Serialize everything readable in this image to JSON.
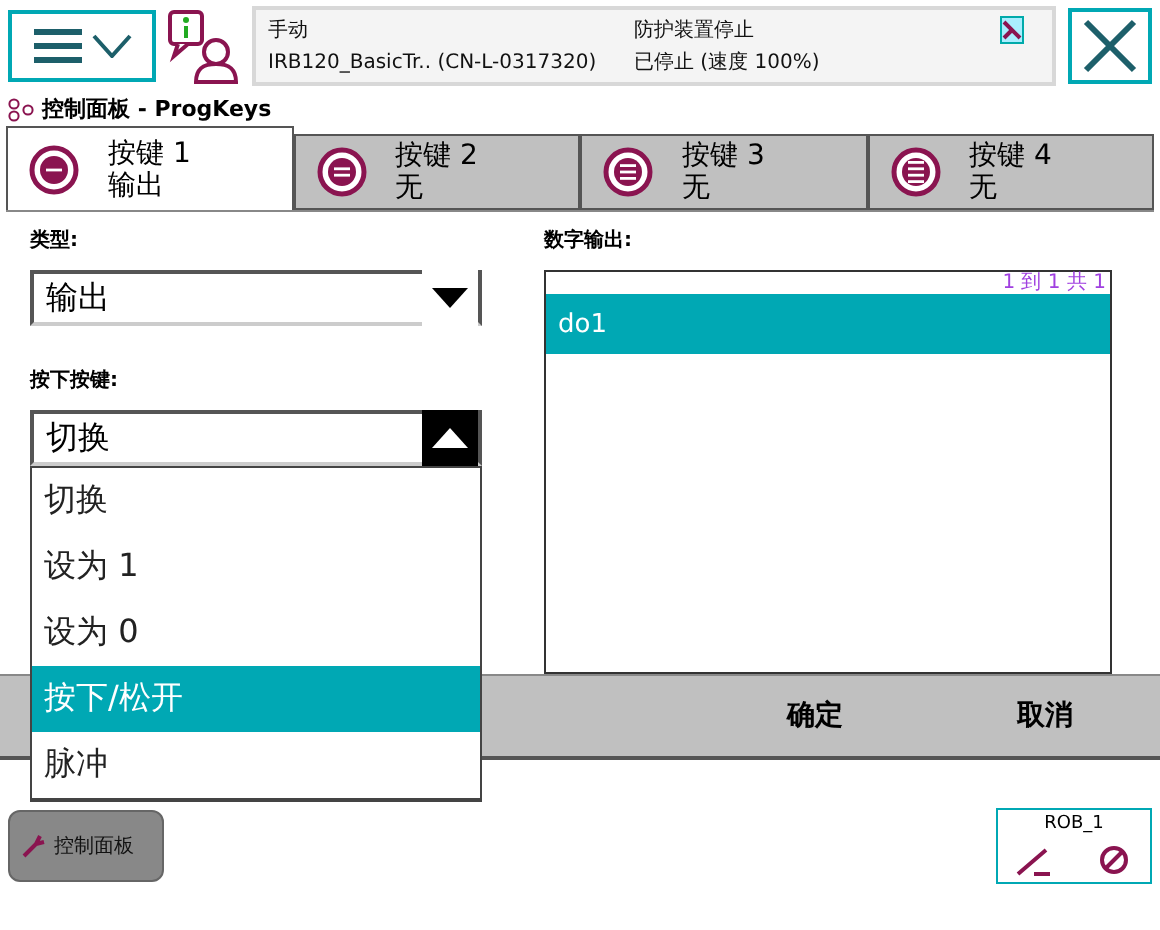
{
  "header": {
    "mode": "手动",
    "controller": "IRB120_BasicTr..  (CN-L-0317320)",
    "safety": "防护装置停止",
    "state": "已停止 (速度 100%)"
  },
  "view_title": "控制面板 - ProgKeys",
  "tabs": [
    {
      "label": "按键 1",
      "value": "输出",
      "selected": true
    },
    {
      "label": "按键 2",
      "value": "无",
      "selected": false
    },
    {
      "label": "按键 3",
      "value": "无",
      "selected": false
    },
    {
      "label": "按键 4",
      "value": "无",
      "selected": false
    }
  ],
  "type_field": {
    "label": "类型:",
    "value": "输出"
  },
  "press_field": {
    "label": "按下按键:",
    "value": "切换",
    "expanded": true,
    "options": [
      {
        "label": "切换",
        "highlighted": false
      },
      {
        "label": "设为 1",
        "highlighted": false
      },
      {
        "label": "设为 0",
        "highlighted": false
      },
      {
        "label": "按下/松开",
        "highlighted": true
      },
      {
        "label": "脉冲",
        "highlighted": false
      }
    ]
  },
  "digital_output": {
    "label": "数字输出:",
    "paging": "1 到 1 共 1",
    "items": [
      {
        "label": "do1",
        "selected": true
      }
    ]
  },
  "buttons": [
    "确定",
    "取消"
  ],
  "taskbar": {
    "app": "控制面板",
    "robot": "ROB_1"
  }
}
